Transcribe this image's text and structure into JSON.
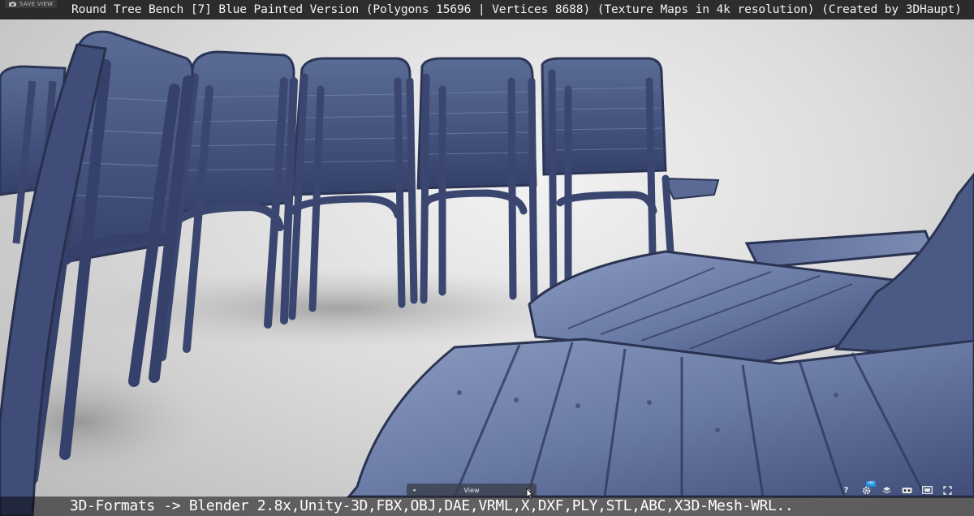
{
  "header": {
    "title": "Round Tree Bench [7] Blue Painted Version (Polygons 15696 | Vertices 8688) (Texture Maps in 4k resolution) (Created by 3DHaupt)",
    "save_view_label": "SAVE VIEW"
  },
  "viewer": {
    "view_label": "View",
    "toolbar": {
      "help_label": "?",
      "settings_badge": "HD"
    }
  },
  "footer": {
    "formats_text": "3D-Formats -> Blender 2.8x,Unity-3D,FBX,OBJ,DAE,VRML,X,DXF,PLY,STL,ABC,X3D-Mesh-WRL.."
  },
  "colors": {
    "background": "#dcdcdc",
    "bench_paint": "#4a5a80",
    "bench_dark": "#2a3352",
    "title_bar": "#141416"
  }
}
